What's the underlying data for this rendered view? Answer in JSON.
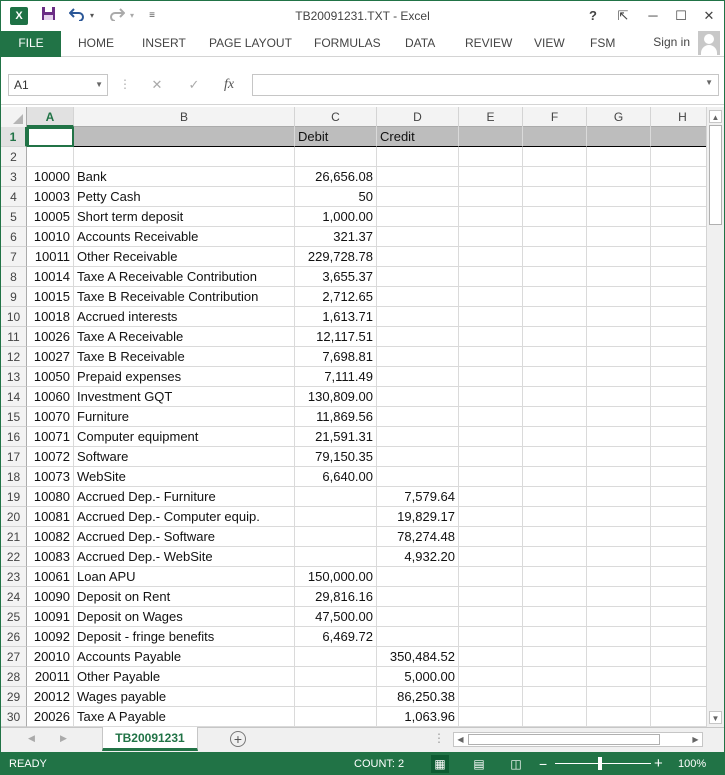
{
  "window": {
    "title": "TB20091231.TXT - Excel",
    "logo": "X",
    "help": "?",
    "restore_ribbon": "⇱",
    "minimize": "─",
    "maximize": "☐",
    "close": "✕"
  },
  "qat": {
    "save_icon": "save-icon",
    "undo_icon": "undo-icon",
    "redo_icon": "redo-icon",
    "customize_icon": "customize-icon"
  },
  "ribbon": {
    "tabs": [
      "FILE",
      "HOME",
      "INSERT",
      "PAGE LAYOUT",
      "FORMULAS",
      "DATA",
      "REVIEW",
      "VIEW",
      "FSM"
    ],
    "sign_in": "Sign in"
  },
  "formula_bar": {
    "name_box": "A1",
    "cancel": "✕",
    "enter": "✓",
    "fx": "fx",
    "content": ""
  },
  "grid": {
    "columns": [
      "A",
      "B",
      "C",
      "D",
      "E",
      "F",
      "G",
      "H"
    ],
    "selected_column": "A",
    "selected_row": 1,
    "rows": [
      {
        "n": "1",
        "a": "",
        "b": "",
        "c": "Debit",
        "d": "Credit"
      },
      {
        "n": "2",
        "a": "",
        "b": "",
        "c": "",
        "d": ""
      },
      {
        "n": "3",
        "a": "10000",
        "b": "Bank",
        "c": "26,656.08",
        "d": ""
      },
      {
        "n": "4",
        "a": "10003",
        "b": "Petty Cash",
        "c": "50",
        "d": ""
      },
      {
        "n": "5",
        "a": "10005",
        "b": "Short term deposit",
        "c": "1,000.00",
        "d": ""
      },
      {
        "n": "6",
        "a": "10010",
        "b": "Accounts Receivable",
        "c": "321.37",
        "d": ""
      },
      {
        "n": "7",
        "a": "10011",
        "b": "Other Receivable",
        "c": "229,728.78",
        "d": ""
      },
      {
        "n": "8",
        "a": "10014",
        "b": "Taxe A Receivable Contribution",
        "c": "3,655.37",
        "d": ""
      },
      {
        "n": "9",
        "a": "10015",
        "b": "Taxe B Receivable Contribution",
        "c": "2,712.65",
        "d": ""
      },
      {
        "n": "10",
        "a": "10018",
        "b": "Accrued interests",
        "c": "1,613.71",
        "d": ""
      },
      {
        "n": "11",
        "a": "10026",
        "b": "Taxe A Receivable",
        "c": "12,117.51",
        "d": ""
      },
      {
        "n": "12",
        "a": "10027",
        "b": "Taxe B Receivable",
        "c": "7,698.81",
        "d": ""
      },
      {
        "n": "13",
        "a": "10050",
        "b": "Prepaid expenses",
        "c": "7,111.49",
        "d": ""
      },
      {
        "n": "14",
        "a": "10060",
        "b": "Investment GQT",
        "c": "130,809.00",
        "d": ""
      },
      {
        "n": "15",
        "a": "10070",
        "b": "Furniture",
        "c": "11,869.56",
        "d": ""
      },
      {
        "n": "16",
        "a": "10071",
        "b": "Computer equipment",
        "c": "21,591.31",
        "d": ""
      },
      {
        "n": "17",
        "a": "10072",
        "b": "Software",
        "c": "79,150.35",
        "d": ""
      },
      {
        "n": "18",
        "a": "10073",
        "b": "WebSite",
        "c": "6,640.00",
        "d": ""
      },
      {
        "n": "19",
        "a": "10080",
        "b": "Accrued Dep.- Furniture",
        "c": "",
        "d": "7,579.64"
      },
      {
        "n": "20",
        "a": "10081",
        "b": "Accrued Dep.- Computer equip.",
        "c": "",
        "d": "19,829.17"
      },
      {
        "n": "21",
        "a": "10082",
        "b": "Accrued Dep.- Software",
        "c": "",
        "d": "78,274.48"
      },
      {
        "n": "22",
        "a": "10083",
        "b": "Accrued Dep.- WebSite",
        "c": "",
        "d": "4,932.20"
      },
      {
        "n": "23",
        "a": "10061",
        "b": "Loan APU",
        "c": "150,000.00",
        "d": ""
      },
      {
        "n": "24",
        "a": "10090",
        "b": "Deposit on Rent",
        "c": "29,816.16",
        "d": ""
      },
      {
        "n": "25",
        "a": "10091",
        "b": "Deposit on Wages",
        "c": "47,500.00",
        "d": ""
      },
      {
        "n": "26",
        "a": "10092",
        "b": "Deposit - fringe benefits",
        "c": "6,469.72",
        "d": ""
      },
      {
        "n": "27",
        "a": "20010",
        "b": "Accounts Payable",
        "c": "",
        "d": "350,484.52"
      },
      {
        "n": "28",
        "a": "20011",
        "b": "Other Payable",
        "c": "",
        "d": "5,000.00"
      },
      {
        "n": "29",
        "a": "20012",
        "b": "Wages payable",
        "c": "",
        "d": "86,250.38"
      },
      {
        "n": "30",
        "a": "20026",
        "b": "Taxe A Payable",
        "c": "",
        "d": "1,063.96"
      }
    ]
  },
  "sheets": {
    "active": "TB20091231",
    "add": "+",
    "prev": "◀",
    "next": "▶",
    "dots": "⋮"
  },
  "status": {
    "ready": "READY",
    "count": "COUNT: 2",
    "zoom": "100%",
    "zoom_minus": "−",
    "zoom_plus": "+",
    "view_normal": "▦",
    "view_page_layout": "▤",
    "view_page_break": "◫"
  },
  "colors": {
    "accent": "#217346"
  }
}
